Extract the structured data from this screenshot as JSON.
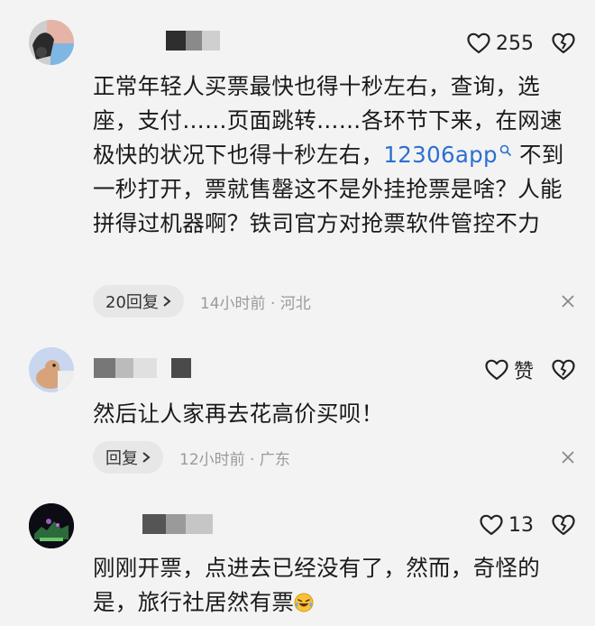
{
  "comments": [
    {
      "likes": "255",
      "text_before_link": "正常年轻人买票最快也得十秒左右，查询，选座，支付……页面跳转……各环节下来，在网速极快的状况下也得十秒左右，",
      "link_text": "12306app",
      "text_after_link": " 不到一秒打开，票就售罄这不是外挂抢票是啥？人能拼得过机器啊？铁司官方对抢票软件管控不力",
      "reply_label": "20回复",
      "time_location": "14小时前 · 河北"
    },
    {
      "likes": "赞",
      "text": "然后让人家再去花高价买呗！",
      "reply_label": "回复",
      "time_location": "12小时前 · 广东"
    },
    {
      "likes": "13",
      "text_before_emoji": "刚刚开票，点进去已经没有了，然而，奇怪的是，旅行社居然有票",
      "emoji": "laughing-crying-emoji"
    }
  ],
  "icons": {
    "like": "heart-outline-icon",
    "dislike": "broken-heart-icon",
    "reply_arrow": "chevron-right-icon",
    "close": "close-icon",
    "search_hint": "search-icon"
  },
  "colors": {
    "background": "#f3f3f3",
    "link": "#2d6fd2",
    "meta_text": "#9a9a9a",
    "pill_bg": "#e7e7e7"
  }
}
